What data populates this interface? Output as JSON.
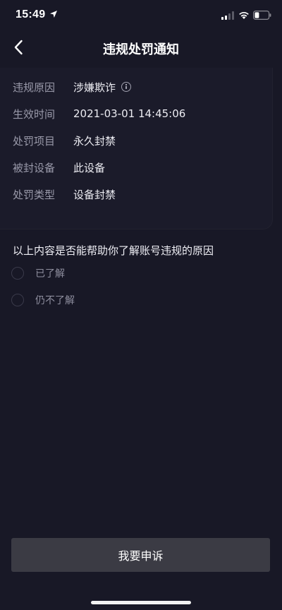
{
  "status_bar": {
    "time": "15:49"
  },
  "nav": {
    "title": "违规处罚通知"
  },
  "info": {
    "rows": [
      {
        "label": "违规原因",
        "value": "涉嫌欺诈"
      },
      {
        "label": "生效时间",
        "value": "2021-03-01 14:45:06"
      },
      {
        "label": "处罚项目",
        "value": "永久封禁"
      },
      {
        "label": "被封设备",
        "value": "此设备"
      },
      {
        "label": "处罚类型",
        "value": "设备封禁"
      }
    ]
  },
  "survey": {
    "question": "以上内容是否能帮助你了解账号违规的原因",
    "options": [
      {
        "label": "已了解"
      },
      {
        "label": "仍不了解"
      }
    ]
  },
  "actions": {
    "appeal_label": "我要申诉"
  },
  "icons": {
    "back": "chevron-left-icon",
    "info": "info-circle-icon",
    "signal": "cellular-signal-icon",
    "wifi": "wifi-icon",
    "battery": "battery-icon",
    "location": "location-arrow-icon"
  },
  "colors": {
    "background": "#181826",
    "button": "#3b3b44",
    "label": "#9a9aaa",
    "text": "#ececf2"
  }
}
